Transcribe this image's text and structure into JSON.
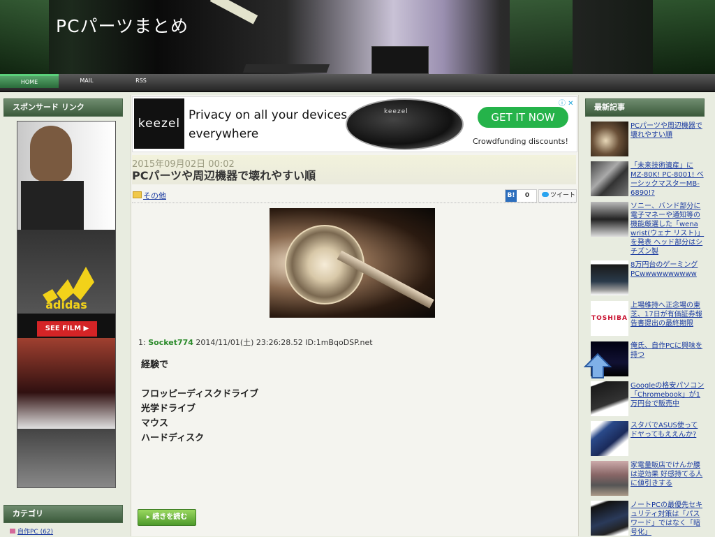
{
  "site": {
    "title": "PCパーツまとめ"
  },
  "nav": [
    {
      "label": "HOME"
    },
    {
      "label": "MAIL"
    },
    {
      "label": "RSS"
    }
  ],
  "left_sidebar": {
    "sponsor_heading": "スポンサード リンク",
    "ad": {
      "brand": "adidas",
      "button": "SEE FILM"
    },
    "category_heading": "カテゴリ",
    "category_link": "自作PC (62)"
  },
  "banner": {
    "brand": "keezel",
    "headline_line1": "Privacy on all your devices,",
    "headline_line2": "everywhere",
    "device_label": "keezel",
    "cta": "GET IT NOW",
    "sub": "Crowdfunding discounts!",
    "adchoice": "ⓘ ✕"
  },
  "post": {
    "date": "2015年09月02日 00:02",
    "title": "PCパーツや周辺機器で壊れやすい順",
    "category": "その他",
    "hatena_label": "B!",
    "hatena_count": "0",
    "tweet_label": "ツイート",
    "comment": {
      "number": "1:",
      "name": "Socket774",
      "meta": "2014/11/01(土) 23:26:28.52 ID:1mBqoDSP.net",
      "lines": [
        "経験で",
        "",
        "フロッピーディスクドライブ",
        "光学ドライブ",
        "マウス",
        "ハードディスク"
      ]
    },
    "readmore": "続きを読む"
  },
  "right_sidebar": {
    "heading": "最新記事",
    "items": [
      {
        "title": "PCパーツや周辺機器で壊れやすい順"
      },
      {
        "title": "「未来技術遺産」にMZ-80K! PC-8001! ベーシックマスターMB-6890!?"
      },
      {
        "title": "ソニー、バンド部分に電子マネーや通知等の機能厳選した「wena wrist(ウェナ リスト)」を発表 ヘッド部分はシチズン製"
      },
      {
        "title": "8万円台のゲーミングPCwwwwwwwwww"
      },
      {
        "title": "上場維持へ正念場の東芝、17日が有価証券報告書提出の最終期限"
      },
      {
        "title": "俺氏、自作PCに興味を持つ"
      },
      {
        "title": "Googleの格安パソコン「Chromebook」が1万円台で販売中"
      },
      {
        "title": "スタバでASUS使ってドヤってもええんか?"
      },
      {
        "title": "家電量販店でけんか腰は逆効果 好感持てる人に値引きする"
      },
      {
        "title": "ノートPCの最優先セキュリティ対策は「パスワード」ではなく「暗号化」"
      }
    ],
    "toshiba_text": "TOSHIBA"
  },
  "colors": {
    "accent_green": "#25b34a",
    "link": "#1a3aa0",
    "sidebar_head": "#4a664a"
  }
}
